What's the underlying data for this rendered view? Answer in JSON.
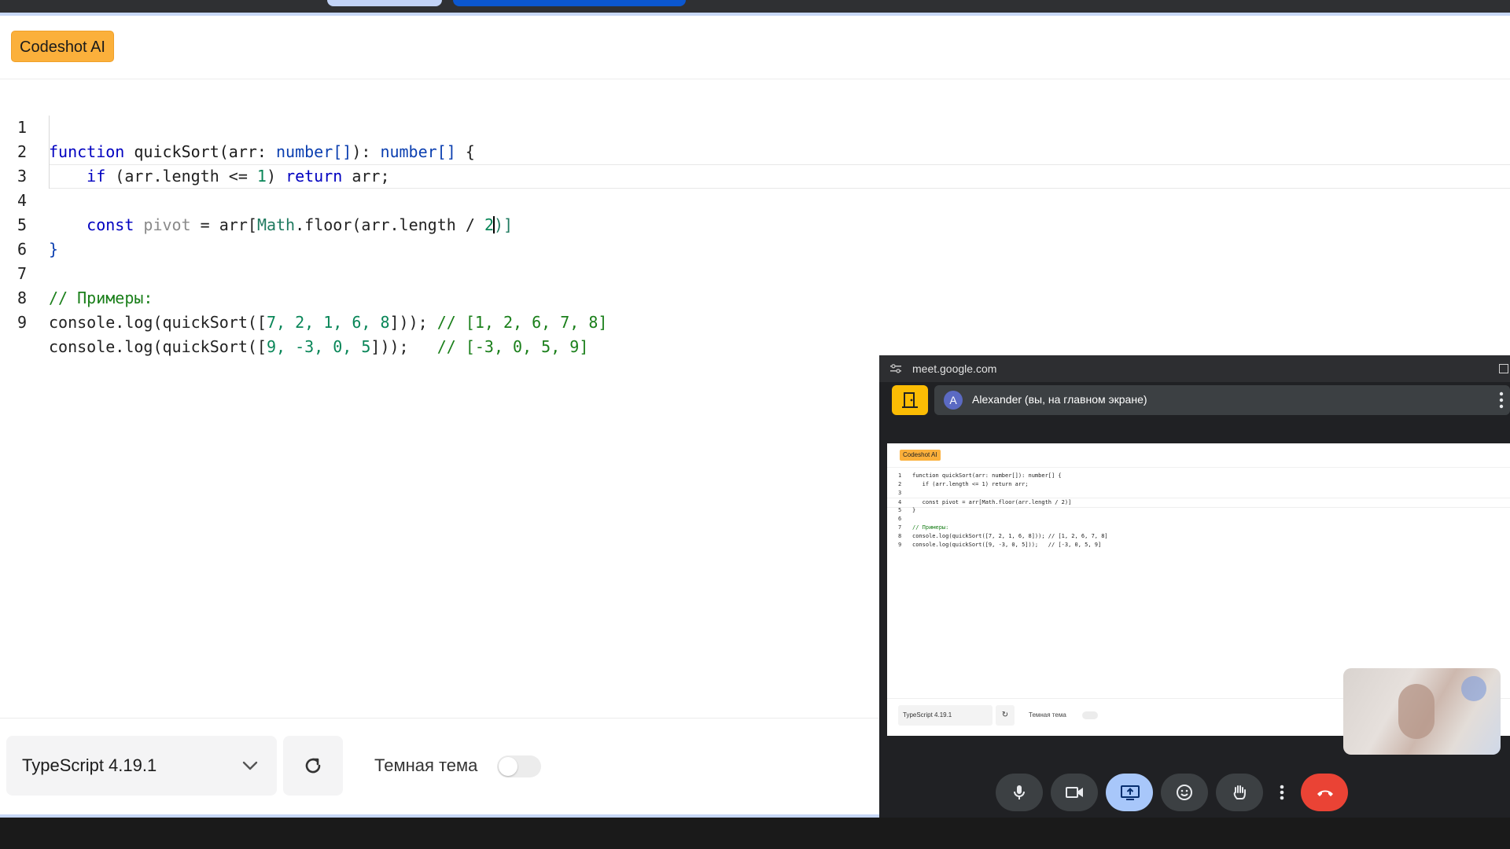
{
  "app": {
    "brand": "Codeshot AI"
  },
  "editor": {
    "lines": [
      {
        "n": "1"
      },
      {
        "n": "2"
      },
      {
        "n": "3"
      },
      {
        "n": "4"
      },
      {
        "n": "5"
      },
      {
        "n": "6"
      },
      {
        "n": "7"
      },
      {
        "n": "8"
      },
      {
        "n": "9"
      }
    ],
    "code": {
      "l1_kw": "function",
      "l1_fn": " quickSort(arr: ",
      "l1_ty1": "number[]",
      "l1_mid": "): ",
      "l1_ty2": "number[]",
      "l1_end": " {",
      "l2_kw1": "if",
      "l2_a": " (arr.length <= ",
      "l2_num": "1",
      "l2_b": ") ",
      "l2_kw2": "return",
      "l2_c": " arr;",
      "l4_kw": "const",
      "l4_var": " pivot",
      "l4_a": " = arr[",
      "l4_fn": "Math",
      "l4_b": ".floor(arr.length / ",
      "l4_num": "2",
      "l4_c": ")]",
      "l5": "}",
      "l7": "// Примеры:",
      "l8_a": "console.log(quickSort([",
      "l8_nums": "7, 2, 1, 6, 8",
      "l8_b": "])); ",
      "l8_cm": "// [1, 2, 6, 7, 8]",
      "l9_a": "console.log(quickSort([",
      "l9_nums": "9, -3, 0, 5",
      "l9_b": "]));   ",
      "l9_cm": "// [-3, 0, 5, 9]"
    }
  },
  "toolbar": {
    "language": "TypeScript 4.19.1",
    "theme_label": "Темная тема",
    "dark_theme_on": false
  },
  "meet": {
    "url": "meet.google.com",
    "avatar_letter": "A",
    "presenter": "Alexander (вы, на главном экране)",
    "shared": {
      "brand": "Codeshot AI",
      "lines": [
        {
          "n": "1",
          "t": "function quickSort(arr: number[]): number[] {"
        },
        {
          "n": "2",
          "t": "   if (arr.length <= 1) return arr;"
        },
        {
          "n": "3",
          "t": ""
        },
        {
          "n": "4",
          "t": "   const pivot = arr[Math.floor(arr.length / 2)]"
        },
        {
          "n": "5",
          "t": "}"
        },
        {
          "n": "6",
          "t": ""
        },
        {
          "n": "7",
          "t": "// Примеры:"
        },
        {
          "n": "8",
          "t": "console.log(quickSort([7, 2, 1, 6, 8])); // [1, 2, 6, 7, 8]"
        },
        {
          "n": "9",
          "t": "console.log(quickSort([9, -3, 0, 5]));   // [-3, 0, 5, 9]"
        }
      ],
      "language": "TypeScript 4.19.1",
      "reset": "↻",
      "theme_label": "Темная тема"
    }
  },
  "colors": {
    "brand": "#fbb03b",
    "meet_accent": "#a8c7fa",
    "end_call": "#ea4335"
  }
}
